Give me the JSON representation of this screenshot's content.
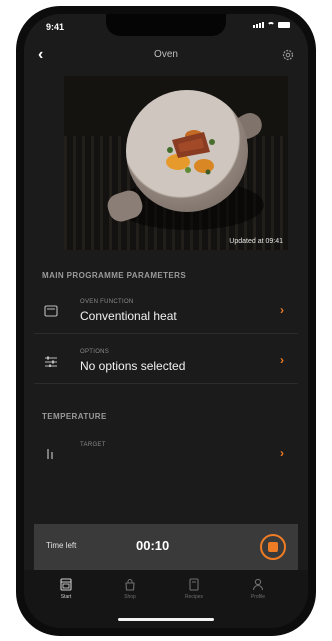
{
  "status": {
    "time": "9:41"
  },
  "header": {
    "title": "Oven"
  },
  "camera": {
    "updated_text": "Updated at 09:41"
  },
  "main_programme": {
    "section_title": "MAIN PROGRAMME PARAMETERS",
    "oven_function": {
      "label": "OVEN FUNCTION",
      "value": "Conventional heat",
      "icon": "oven-icon"
    },
    "options": {
      "label": "OPTIONS",
      "value": "No options selected",
      "icon": "sliders-icon"
    }
  },
  "temperature": {
    "section_title": "TEMPERATURE",
    "target_label": "TARGET"
  },
  "timer": {
    "label": "Time left",
    "value": "00:10"
  },
  "tabs": [
    {
      "label": "Start",
      "icon": "oven-icon",
      "active": true
    },
    {
      "label": "Shop",
      "icon": "bag-icon",
      "active": false
    },
    {
      "label": "Recipes",
      "icon": "book-icon",
      "active": false
    },
    {
      "label": "Profile",
      "icon": "person-icon",
      "active": false
    }
  ],
  "colors": {
    "accent": "#ee7c25",
    "background": "#1b1b1b",
    "bar": "#3a3a3a"
  }
}
